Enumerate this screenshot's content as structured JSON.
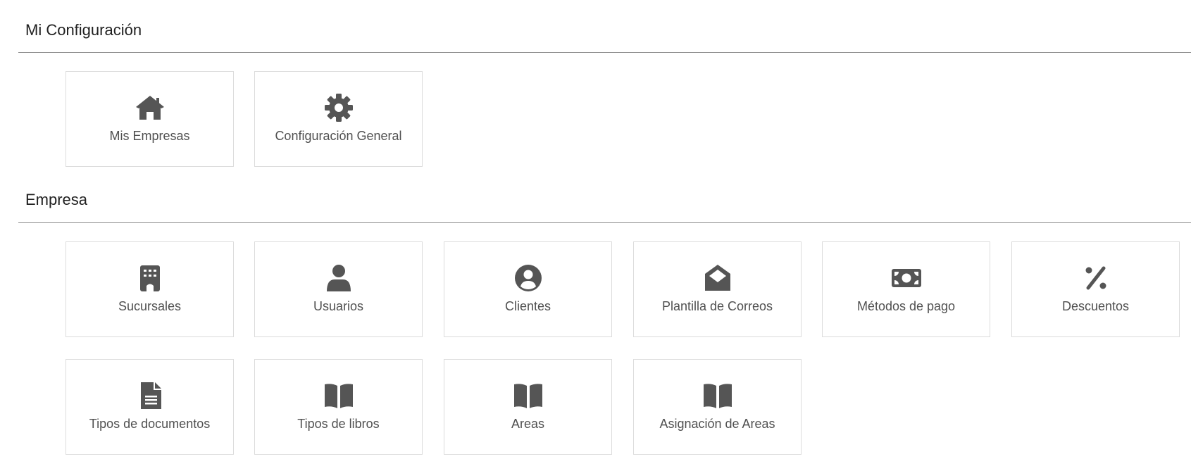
{
  "sections": {
    "mi_configuracion": {
      "title": "Mi Configuración",
      "tiles": [
        {
          "label": "Mis Empresas",
          "icon": "home-icon"
        },
        {
          "label": "Configuración General",
          "icon": "gear-icon"
        }
      ]
    },
    "empresa": {
      "title": "Empresa",
      "tiles": [
        {
          "label": "Sucursales",
          "icon": "building-icon"
        },
        {
          "label": "Usuarios",
          "icon": "user-icon"
        },
        {
          "label": "Clientes",
          "icon": "user-circle-icon"
        },
        {
          "label": "Plantilla de Correos",
          "icon": "envelope-open-icon"
        },
        {
          "label": "Métodos de pago",
          "icon": "money-bill-icon"
        },
        {
          "label": "Descuentos",
          "icon": "percent-icon"
        },
        {
          "label": "Tipos de documentos",
          "icon": "document-icon"
        },
        {
          "label": "Tipos de libros",
          "icon": "book-open-icon"
        },
        {
          "label": "Areas",
          "icon": "book-open-icon"
        },
        {
          "label": "Asignación de Areas",
          "icon": "book-open-icon"
        }
      ]
    }
  },
  "colors": {
    "icon": "#555555",
    "label": "#505050",
    "title": "#212121",
    "tile_border": "#dcdcdc",
    "divider": "#8a8a8a"
  }
}
